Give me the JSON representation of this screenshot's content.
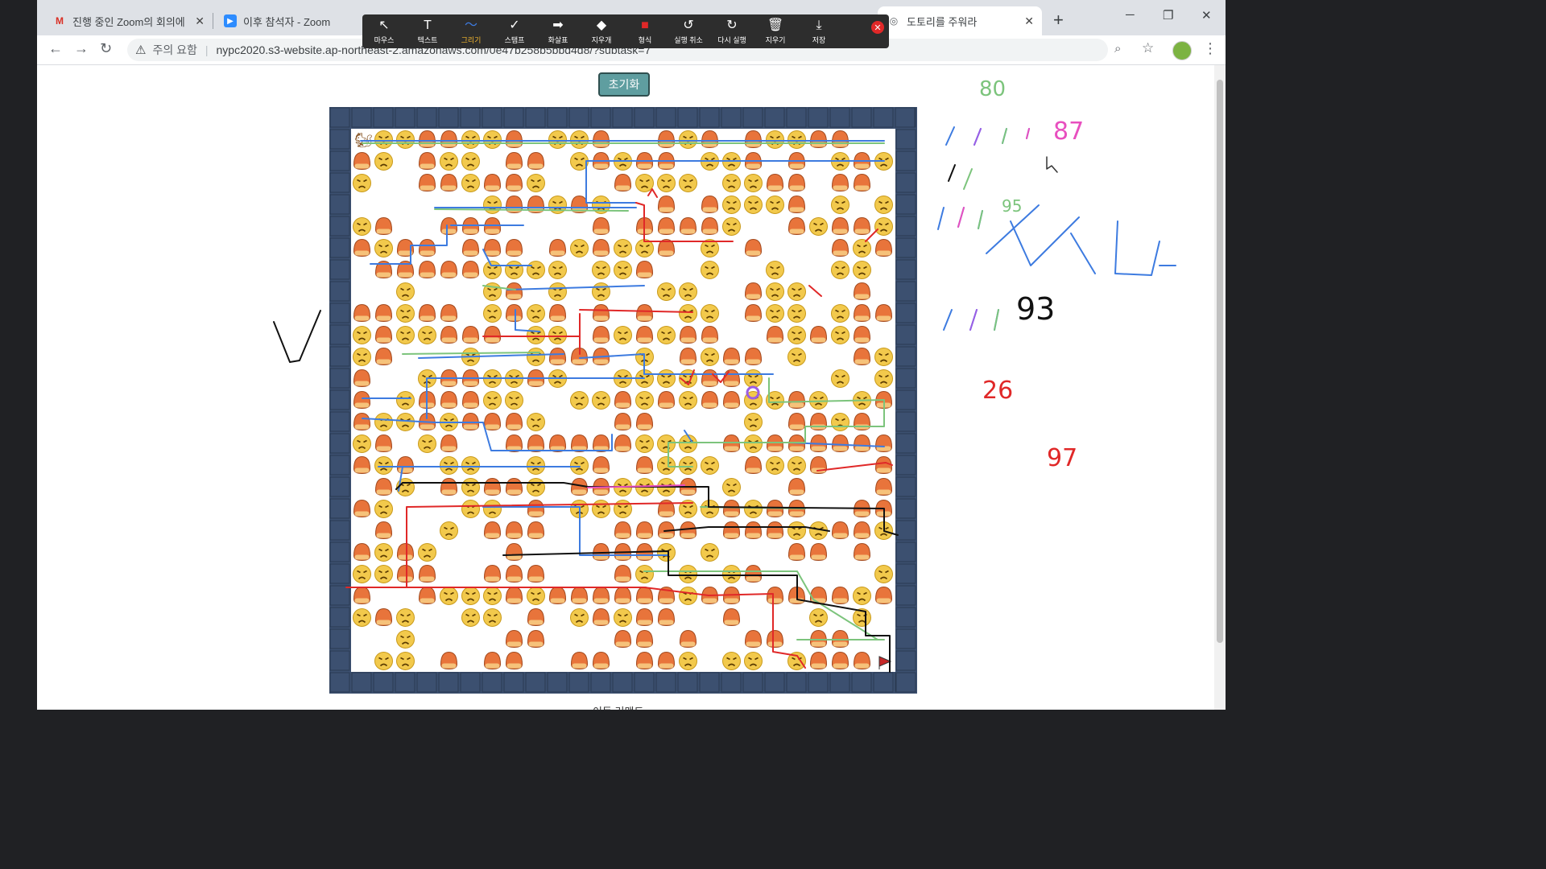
{
  "tabs": [
    {
      "label": "진행 중인 Zoom의 회의에",
      "icon": "gmail-icon"
    },
    {
      "label": "이후 참석자 - Zoom",
      "icon": "zoom-icon"
    },
    {
      "label": "도토리를 주워라",
      "icon": "globe-icon",
      "active": true
    }
  ],
  "window_controls": {
    "minimize": "─",
    "restore": "❐",
    "close": "✕",
    "new_tab": "+"
  },
  "address_bar": {
    "warning": "주의 요함",
    "url": "nypc2020.s3-website.ap-northeast-2.amazonaws.com/0e47b258b5bbd4d8/?subtask=7"
  },
  "zoom_toolbar": {
    "tools": [
      {
        "label": "마우스",
        "icon": "cursor-icon",
        "glyph": "↖"
      },
      {
        "label": "텍스트",
        "icon": "text-icon",
        "glyph": "T"
      },
      {
        "label": "그리기",
        "icon": "draw-icon",
        "glyph": "〜",
        "active": true
      },
      {
        "label": "스탬프",
        "icon": "stamp-icon",
        "glyph": "✓"
      },
      {
        "label": "화살표",
        "icon": "arrow-icon",
        "glyph": "➡"
      },
      {
        "label": "지우개",
        "icon": "eraser-icon",
        "glyph": "◆"
      },
      {
        "label": "형식",
        "icon": "format-icon",
        "glyph": "■"
      },
      {
        "label": "실행 취소",
        "icon": "undo-icon",
        "glyph": "↺"
      },
      {
        "label": "다시 실행",
        "icon": "redo-icon",
        "glyph": "↻"
      },
      {
        "label": "지우기",
        "icon": "trash-icon",
        "glyph": "🗑"
      },
      {
        "label": "저장",
        "icon": "save-icon",
        "glyph": "⤓"
      }
    ],
    "close_glyph": "✕"
  },
  "page": {
    "reset_button": "초기화",
    "bottom_text": "이동 커맨드"
  },
  "annotations": {
    "n1": "80",
    "n2": "87",
    "n3": "93",
    "n4": "26",
    "n5": "97",
    "n6": "95"
  },
  "colors": {
    "wall": "#3c5070",
    "chestnut": "#e8743b",
    "angry_face": "#f2c94c",
    "reset_button": "#5f9ea0",
    "goal_flag": "#c62828"
  }
}
